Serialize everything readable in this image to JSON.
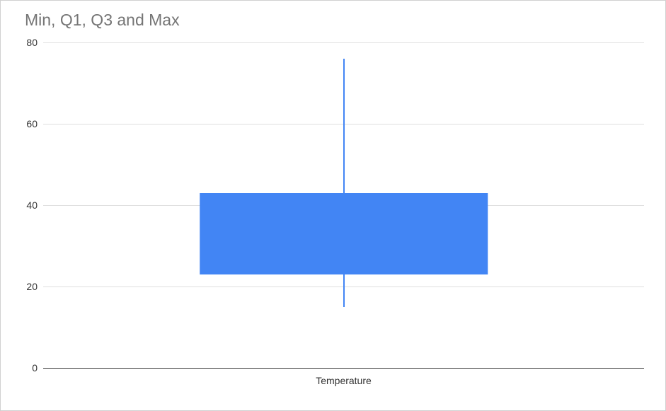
{
  "chart_data": {
    "type": "boxplot",
    "title": "Min, Q1, Q3 and Max",
    "categories": [
      "Temperature"
    ],
    "series": [
      {
        "name": "Temperature",
        "min": 15,
        "q1": 23,
        "q3": 43,
        "max": 76
      }
    ],
    "ylim": [
      0,
      80
    ],
    "yticks": [
      0,
      20,
      40,
      60,
      80
    ],
    "xlabel": "Temperature",
    "ylabel": "",
    "box_color": "#4285f4"
  }
}
